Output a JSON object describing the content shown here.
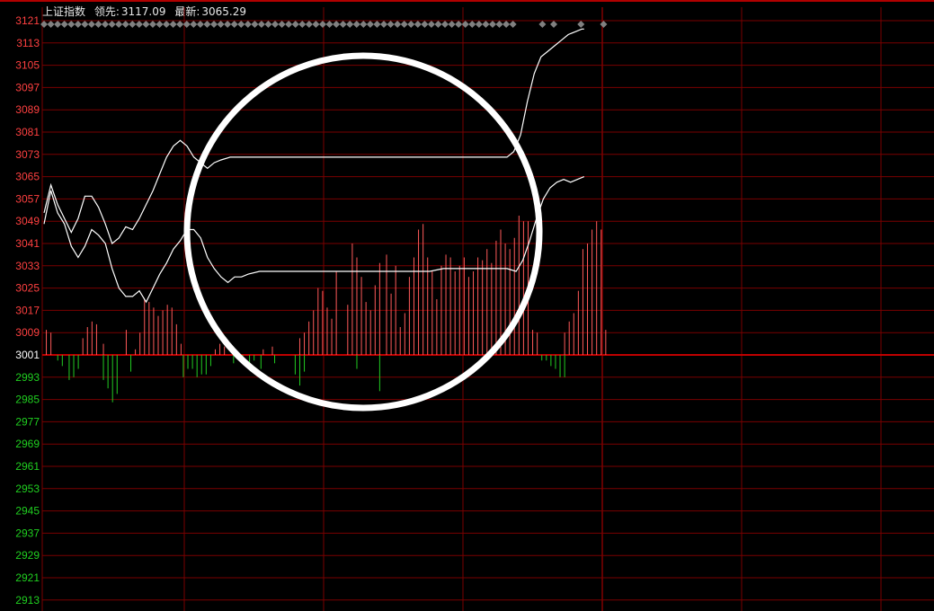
{
  "header": {
    "index_name": "上证指数",
    "lead_label": "领先:",
    "lead_value": "3117.09",
    "latest_label": "最新:",
    "latest_value": "3065.29"
  },
  "colors": {
    "background": "#000000",
    "grid": "#7a0000",
    "baseline": "#c00000",
    "up_label": "#ff4040",
    "down_label": "#20d020",
    "base_label": "#ffffff",
    "up_bar": "#ff5a5a",
    "down_bar": "#22cc22",
    "line_white": "#ffffff",
    "line_lead": "#ffffff",
    "marker": "#808080",
    "annotation_circle": "#ffffff"
  },
  "chart_data": {
    "type": "line",
    "baseline": 3001,
    "ylim": [
      2909,
      3121
    ],
    "y_ticks_up": [
      3121,
      3113,
      3105,
      3097,
      3089,
      3081,
      3073,
      3065,
      3057,
      3049,
      3041,
      3033,
      3025,
      3017,
      3009
    ],
    "y_tick_base": 3001,
    "y_ticks_down": [
      2993,
      2985,
      2977,
      2969,
      2961,
      2953,
      2945,
      2937,
      2929,
      2921,
      2913
    ],
    "x_range": [
      0,
      240
    ],
    "series": [
      {
        "role": "lead",
        "points": [
          [
            0,
            3048
          ],
          [
            3,
            3060
          ],
          [
            6,
            3052
          ],
          [
            9,
            3048
          ],
          [
            12,
            3040
          ],
          [
            15,
            3036
          ],
          [
            18,
            3040
          ],
          [
            21,
            3046
          ],
          [
            24,
            3044
          ],
          [
            27,
            3041
          ],
          [
            30,
            3032
          ],
          [
            33,
            3025
          ],
          [
            36,
            3022
          ],
          [
            39,
            3022
          ],
          [
            42,
            3024
          ],
          [
            45,
            3020
          ],
          [
            48,
            3025
          ],
          [
            51,
            3030
          ],
          [
            54,
            3034
          ],
          [
            57,
            3039
          ],
          [
            60,
            3042
          ],
          [
            63,
            3046
          ],
          [
            66,
            3046
          ],
          [
            69,
            3043
          ],
          [
            72,
            3036
          ],
          [
            75,
            3032
          ],
          [
            78,
            3029
          ],
          [
            81,
            3027
          ],
          [
            84,
            3029
          ],
          [
            87,
            3029
          ],
          [
            90,
            3030
          ],
          [
            95,
            3031
          ],
          [
            100,
            3031
          ],
          [
            106,
            3031
          ],
          [
            112,
            3031
          ],
          [
            120,
            3031
          ],
          [
            130,
            3031
          ],
          [
            140,
            3031
          ],
          [
            150,
            3031
          ],
          [
            160,
            3031
          ],
          [
            170,
            3031
          ],
          [
            176,
            3032
          ],
          [
            182,
            3032
          ],
          [
            188,
            3032
          ],
          [
            194,
            3032
          ],
          [
            200,
            3032
          ],
          [
            204,
            3032
          ],
          [
            208,
            3031
          ],
          [
            211,
            3035
          ],
          [
            214,
            3042
          ],
          [
            217,
            3050
          ],
          [
            220,
            3057
          ],
          [
            223,
            3061
          ],
          [
            226,
            3063
          ],
          [
            229,
            3064
          ],
          [
            232,
            3063
          ],
          [
            235,
            3064
          ],
          [
            238,
            3065
          ]
        ]
      },
      {
        "role": "price",
        "points": [
          [
            0,
            3052
          ],
          [
            3,
            3062
          ],
          [
            6,
            3055
          ],
          [
            9,
            3050
          ],
          [
            12,
            3045
          ],
          [
            15,
            3050
          ],
          [
            18,
            3058
          ],
          [
            21,
            3058
          ],
          [
            24,
            3054
          ],
          [
            27,
            3048
          ],
          [
            30,
            3041
          ],
          [
            33,
            3043
          ],
          [
            36,
            3047
          ],
          [
            39,
            3046
          ],
          [
            42,
            3050
          ],
          [
            45,
            3055
          ],
          [
            48,
            3060
          ],
          [
            51,
            3066
          ],
          [
            54,
            3072
          ],
          [
            57,
            3076
          ],
          [
            60,
            3078
          ],
          [
            63,
            3076
          ],
          [
            66,
            3072
          ],
          [
            69,
            3070
          ],
          [
            72,
            3068
          ],
          [
            75,
            3070
          ],
          [
            78,
            3071
          ],
          [
            82,
            3072
          ],
          [
            88,
            3072
          ],
          [
            95,
            3072
          ],
          [
            105,
            3072
          ],
          [
            115,
            3072
          ],
          [
            125,
            3072
          ],
          [
            135,
            3072
          ],
          [
            145,
            3072
          ],
          [
            155,
            3072
          ],
          [
            165,
            3072
          ],
          [
            175,
            3072
          ],
          [
            185,
            3072
          ],
          [
            195,
            3072
          ],
          [
            200,
            3072
          ],
          [
            204,
            3072
          ],
          [
            207,
            3074
          ],
          [
            210,
            3080
          ],
          [
            213,
            3092
          ],
          [
            216,
            3102
          ],
          [
            219,
            3108
          ],
          [
            222,
            3110
          ],
          [
            225,
            3112
          ],
          [
            228,
            3114
          ],
          [
            231,
            3116
          ],
          [
            234,
            3117
          ],
          [
            237,
            3118
          ],
          [
            238,
            3118
          ]
        ]
      }
    ],
    "volume_bars": {
      "up": [
        [
          1,
          9
        ],
        [
          3,
          8
        ],
        [
          17,
          6
        ],
        [
          19,
          10
        ],
        [
          21,
          12
        ],
        [
          23,
          11
        ],
        [
          26,
          4
        ],
        [
          36,
          9
        ],
        [
          40,
          2
        ],
        [
          42,
          8
        ],
        [
          44,
          20
        ],
        [
          46,
          19
        ],
        [
          48,
          17
        ],
        [
          50,
          14
        ],
        [
          52,
          16
        ],
        [
          54,
          18
        ],
        [
          56,
          17
        ],
        [
          58,
          11
        ],
        [
          60,
          4
        ],
        [
          75,
          2
        ],
        [
          77,
          4
        ],
        [
          79,
          3
        ],
        [
          96,
          2
        ],
        [
          100,
          3
        ],
        [
          112,
          6
        ],
        [
          114,
          8
        ],
        [
          116,
          12
        ],
        [
          118,
          16
        ],
        [
          120,
          24
        ],
        [
          122,
          23
        ],
        [
          124,
          17
        ],
        [
          126,
          13
        ],
        [
          128,
          30
        ],
        [
          133,
          18
        ],
        [
          135,
          40
        ],
        [
          137,
          35
        ],
        [
          139,
          28
        ],
        [
          141,
          19
        ],
        [
          143,
          16
        ],
        [
          145,
          25
        ],
        [
          147,
          33
        ],
        [
          150,
          36
        ],
        [
          152,
          22
        ],
        [
          154,
          32
        ],
        [
          156,
          10
        ],
        [
          158,
          15
        ],
        [
          160,
          28
        ],
        [
          162,
          35
        ],
        [
          164,
          45
        ],
        [
          166,
          47
        ],
        [
          168,
          35
        ],
        [
          170,
          30
        ],
        [
          172,
          20
        ],
        [
          174,
          32
        ],
        [
          176,
          36
        ],
        [
          178,
          35
        ],
        [
          180,
          30
        ],
        [
          182,
          32
        ],
        [
          184,
          35
        ],
        [
          186,
          28
        ],
        [
          188,
          30
        ],
        [
          190,
          35
        ],
        [
          192,
          34
        ],
        [
          194,
          38
        ],
        [
          196,
          33
        ],
        [
          198,
          41
        ],
        [
          200,
          45
        ],
        [
          202,
          40
        ],
        [
          204,
          38
        ],
        [
          206,
          42
        ],
        [
          208,
          50
        ],
        [
          210,
          48
        ],
        [
          212,
          48
        ],
        [
          214,
          9
        ],
        [
          216,
          8
        ],
        [
          228,
          8
        ],
        [
          230,
          12
        ],
        [
          232,
          15
        ],
        [
          234,
          23
        ],
        [
          236,
          38
        ],
        [
          238,
          40
        ],
        [
          240,
          45
        ],
        [
          242,
          48
        ],
        [
          244,
          45
        ],
        [
          246,
          9
        ]
      ],
      "down": [
        [
          6,
          2
        ],
        [
          8,
          4
        ],
        [
          11,
          9
        ],
        [
          13,
          8
        ],
        [
          15,
          5
        ],
        [
          26,
          9
        ],
        [
          28,
          12
        ],
        [
          30,
          17
        ],
        [
          32,
          14
        ],
        [
          38,
          6
        ],
        [
          61,
          8
        ],
        [
          63,
          5
        ],
        [
          65,
          5
        ],
        [
          67,
          8
        ],
        [
          69,
          7
        ],
        [
          71,
          7
        ],
        [
          73,
          4
        ],
        [
          83,
          3
        ],
        [
          87,
          3
        ],
        [
          90,
          4
        ],
        [
          92,
          2
        ],
        [
          95,
          5
        ],
        [
          101,
          3
        ],
        [
          110,
          7
        ],
        [
          112,
          11
        ],
        [
          114,
          6
        ],
        [
          137,
          5
        ],
        [
          147,
          13
        ],
        [
          218,
          2
        ],
        [
          220,
          2
        ],
        [
          222,
          4
        ],
        [
          224,
          5
        ],
        [
          226,
          8
        ],
        [
          228,
          8
        ]
      ]
    },
    "markers_top": [
      0,
      3,
      6,
      9,
      12,
      15,
      18,
      21,
      24,
      27,
      30,
      33,
      36,
      39,
      42,
      45,
      48,
      51,
      54,
      57,
      60,
      63,
      66,
      69,
      72,
      75,
      78,
      81,
      84,
      87,
      90,
      93,
      96,
      99,
      102,
      105,
      108,
      111,
      114,
      117,
      120,
      123,
      126,
      129,
      132,
      135,
      138,
      141,
      144,
      147,
      150,
      153,
      156,
      159,
      162,
      165,
      168,
      171,
      174,
      177,
      180,
      183,
      186,
      189,
      192,
      195,
      198,
      201,
      204,
      207,
      220,
      225,
      237,
      247
    ]
  }
}
